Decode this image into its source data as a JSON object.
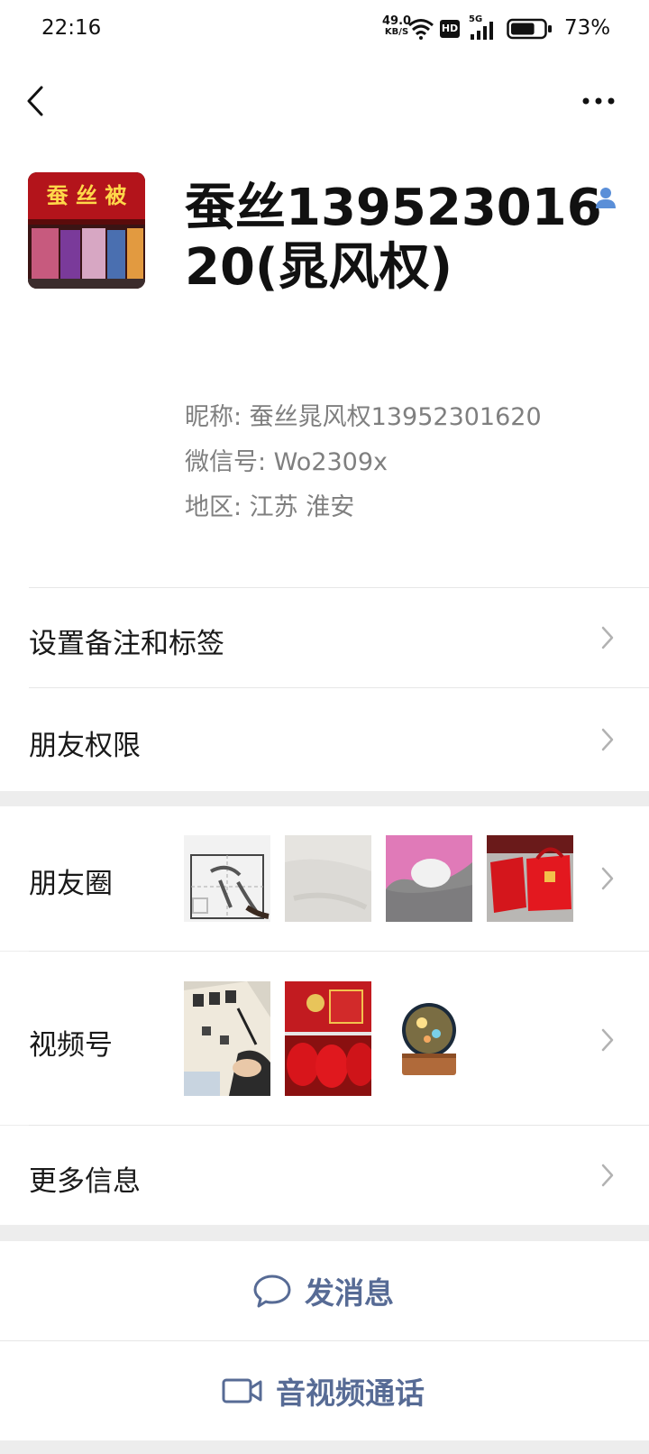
{
  "status_bar": {
    "time": "22:16",
    "net_speed_value": "49.0",
    "net_speed_unit": "KB/S",
    "hd_label": "HD",
    "network_label": "5G",
    "battery_percent": "73%",
    "battery_level": 0.73
  },
  "profile": {
    "name": "蚕丝13952301620(晁风权)",
    "nickname": "昵称:  蚕丝晁风权13952301620",
    "wechat_id": "微信号:  Wo2309x",
    "region": "地区:  江苏  淮安",
    "avatar_sign_text": "蚕 丝 被"
  },
  "menu": {
    "remark_tags": "设置备注和标签",
    "permissions": "朋友权限",
    "moments": "朋友圈",
    "channels": "视频号",
    "more_info": "更多信息"
  },
  "actions": {
    "send_message": "发消息",
    "av_call": "音视频通话"
  },
  "colors": {
    "link_blue": "#576b95",
    "section_gray": "#ededed",
    "badge_blue": "#5a8fd8"
  }
}
